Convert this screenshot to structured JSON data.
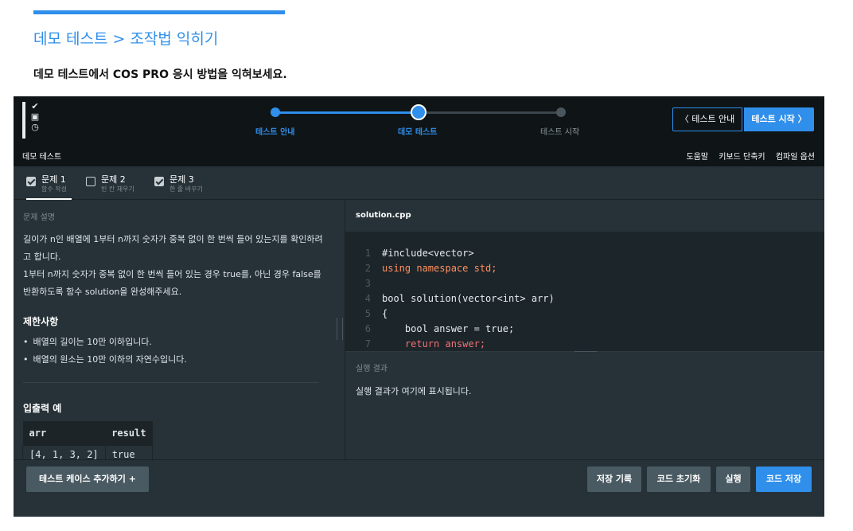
{
  "page": {
    "breadcrumb": "데모 테스트 > 조작법 익히기",
    "intro": "데모 테스트에서 COS PRO 응시 방법을 익혀보세요."
  },
  "header": {
    "steps": [
      {
        "label": "테스트 안내",
        "state": "done"
      },
      {
        "label": "데모 테스트",
        "state": "current"
      },
      {
        "label": "테스트 시작",
        "state": "todo"
      }
    ],
    "guide_button": "〈 테스트 안내",
    "start_button": "테스트 시작 〉",
    "title": "데모 테스트",
    "menu": [
      "도움말",
      "키보드 단축키",
      "컴파일 옵션"
    ],
    "logo_icons": [
      "check-circle-icon",
      "person-card-icon",
      "clock-icon"
    ]
  },
  "tabs": [
    {
      "name": "문제 1",
      "sub": "함수 작성",
      "checked": true,
      "active": true
    },
    {
      "name": "문제 2",
      "sub": "빈 칸 채우기",
      "checked": false,
      "active": false
    },
    {
      "name": "문제 3",
      "sub": "한 줄 바꾸기",
      "checked": true,
      "active": false
    }
  ],
  "problem": {
    "section_label": "문제 설명",
    "description_1": "길이가 n인 배열에 1부터 n까지 숫자가 중복 없이 한 번씩 들어 있는지를 확인하려고 합니다.",
    "description_2": "1부터 n까지 숫자가 중복 없이 한 번씩 들어 있는 경우 true를, 아닌 경우 false를 반환하도록 함수 solution을 완성해주세요.",
    "constraint_title": "제한사항",
    "constraints": [
      "배열의 길이는 10만 이하입니다.",
      "배열의 원소는 10만 이하의 자연수입니다."
    ],
    "io_title": "입출력 예",
    "io_headers": [
      "arr",
      "result"
    ],
    "io_rows": [
      [
        "[4, 1, 3, 2]",
        "true"
      ]
    ]
  },
  "editor": {
    "filename": "solution.cpp",
    "lines": [
      {
        "n": "1",
        "text": "#include<vector>"
      },
      {
        "n": "2",
        "text": "using namespace std;"
      },
      {
        "n": "3",
        "text": ""
      },
      {
        "n": "4",
        "text": "bool solution(vector<int> arr)"
      },
      {
        "n": "5",
        "text": "{"
      },
      {
        "n": "6",
        "text": "    bool answer = true;"
      },
      {
        "n": "7",
        "text": "    return answer;"
      }
    ]
  },
  "result": {
    "label": "실행 결과",
    "text": "실행 결과가 여기에 표시됩니다."
  },
  "footer": {
    "add_case": "테스트 케이스 추가하기 +",
    "history": "저장 기록",
    "reset": "코드 초기화",
    "run": "실행",
    "save": "코드 저장"
  },
  "colors": {
    "accent": "#2f8fea",
    "panel": "#263238",
    "header": "#0f1417"
  }
}
